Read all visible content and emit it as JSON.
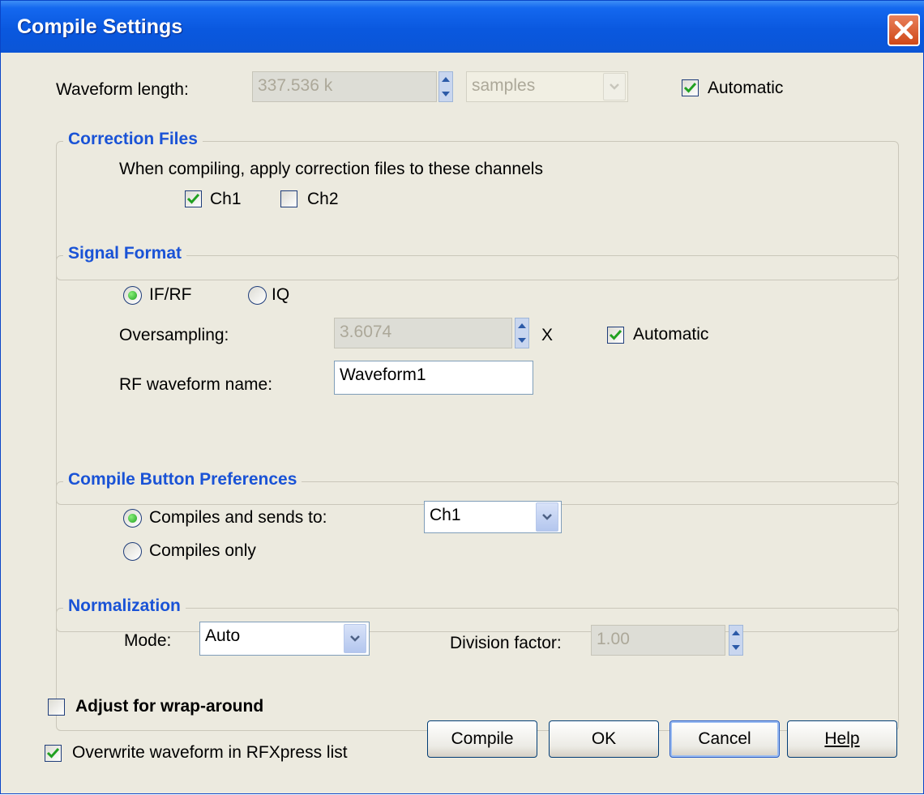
{
  "window": {
    "title": "Compile Settings"
  },
  "waveform_length": {
    "label": "Waveform length:",
    "value": "337.536 k",
    "unit": "samples",
    "automatic_label": "Automatic",
    "automatic_checked": true
  },
  "correction_files": {
    "title": "Correction Files",
    "description": "When compiling, apply correction files to these channels",
    "ch1_label": "Ch1",
    "ch1_checked": true,
    "ch2_label": "Ch2",
    "ch2_checked": false
  },
  "signal_format": {
    "title": "Signal Format",
    "ifrf_label": "IF/RF",
    "iq_label": "IQ",
    "selected": "IF/RF",
    "oversampling_label": "Oversampling:",
    "oversampling_value": "3.6074",
    "oversampling_unit": "X",
    "automatic_label": "Automatic",
    "automatic_checked": true,
    "rf_name_label": "RF waveform name:",
    "rf_name_value": "Waveform1"
  },
  "compile_button_preferences": {
    "title": "Compile Button Preferences",
    "sends_label": "Compiles and sends to:",
    "only_label": "Compiles only",
    "selected": "Compiles and sends to:",
    "target_value": "Ch1"
  },
  "normalization": {
    "title": "Normalization",
    "mode_label": "Mode:",
    "mode_value": "Auto",
    "division_label": "Division factor:",
    "division_value": "1.00"
  },
  "options": {
    "wrap_label": "Adjust for wrap-around",
    "wrap_checked": false,
    "overwrite_label": "Overwrite waveform in RFXpress list",
    "overwrite_checked": true
  },
  "buttons": {
    "compile": "Compile",
    "ok": "OK",
    "cancel": "Cancel",
    "help": "Help"
  },
  "colors": {
    "title_bar": "#0a58df",
    "group_title": "#1a53d6",
    "dialog_background": "#eceadf",
    "check_mark": "#21a121",
    "close_button": "#d8552a"
  },
  "icons": [
    "close-icon",
    "check-icon",
    "spin-up-icon",
    "spin-down-icon",
    "chevron-down-icon"
  ]
}
